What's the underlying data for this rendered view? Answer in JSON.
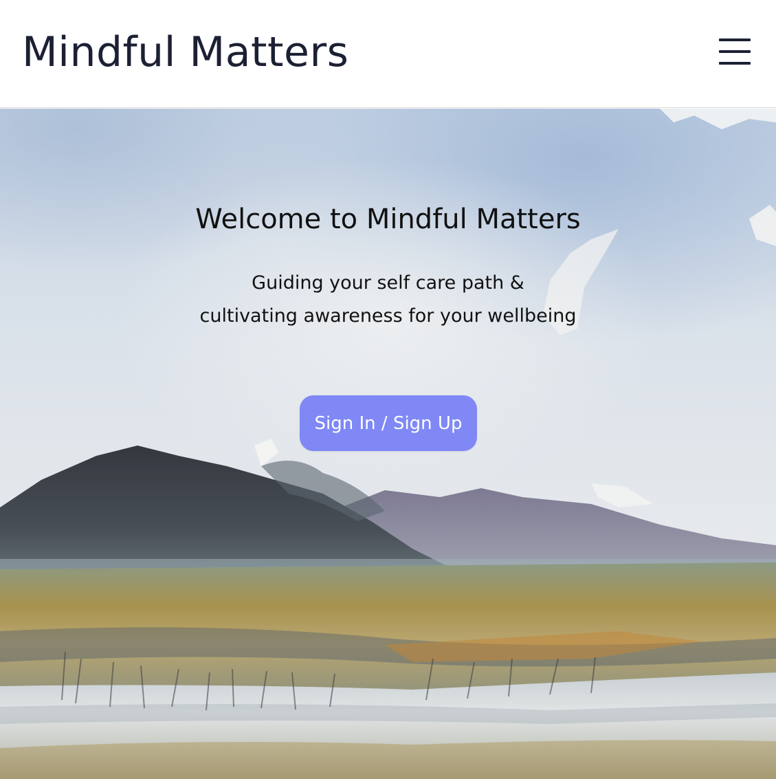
{
  "header": {
    "title": "Mindful Matters",
    "menu_icon": "hamburger-menu-icon"
  },
  "hero": {
    "heading": "Welcome to Mindful Matters",
    "subtitle_line1": "Guiding your self care path &",
    "subtitle_line2": "cultivating awareness for your wellbeing",
    "cta_label": "Sign In / Sign Up",
    "background": "watercolor-landscape-image"
  },
  "colors": {
    "title_text": "#1c2033",
    "cta_background": "#7f88f5",
    "cta_text": "#ffffff",
    "sky": "#c9d6e4",
    "mountain_dark": "#3e4148",
    "mountain_purple": "#8a889c",
    "field_ochre": "#a8924e",
    "water": "#d7dde2"
  }
}
